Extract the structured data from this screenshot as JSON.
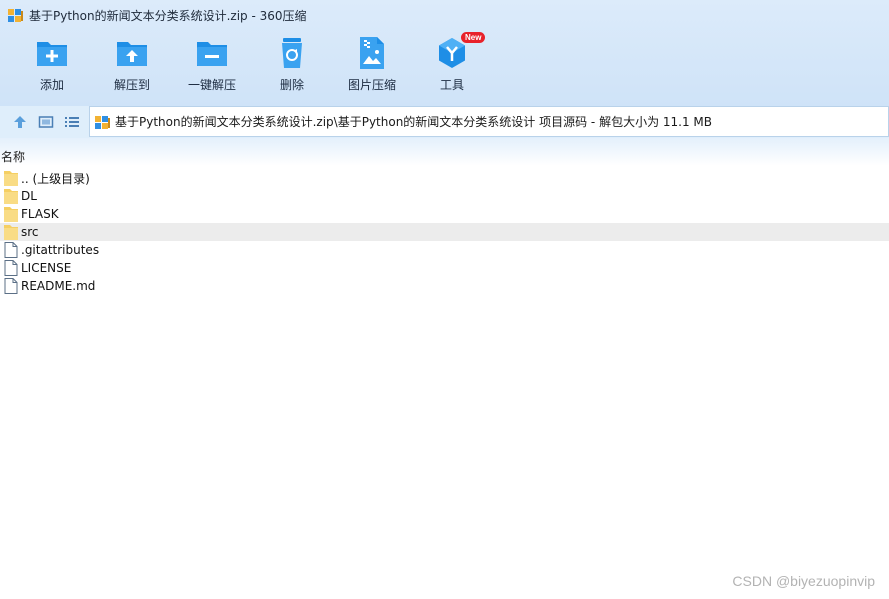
{
  "window": {
    "title": "基于Python的新闻文本分类系统设计.zip - 360压缩"
  },
  "toolbar": {
    "buttons": [
      {
        "label": "添加",
        "icon": "add-folder-icon"
      },
      {
        "label": "解压到",
        "icon": "extract-to-icon"
      },
      {
        "label": "一键解压",
        "icon": "one-click-extract-icon"
      },
      {
        "label": "删除",
        "icon": "recycle-delete-icon"
      },
      {
        "label": "图片压缩",
        "icon": "image-compress-icon"
      },
      {
        "label": "工具",
        "icon": "tools-cube-icon"
      }
    ],
    "new_badge": "New"
  },
  "address": {
    "path": "基于Python的新闻文本分类系统设计.zip\\基于Python的新闻文本分类系统设计 项目源码 - 解包大小为 11.1 MB"
  },
  "list": {
    "column_name": "名称",
    "items": [
      {
        "name": ".. (上级目录)",
        "type": "folder"
      },
      {
        "name": "DL",
        "type": "folder"
      },
      {
        "name": "FLASK",
        "type": "folder"
      },
      {
        "name": "src",
        "type": "folder",
        "selected": true
      },
      {
        "name": ".gitattributes",
        "type": "file"
      },
      {
        "name": "LICENSE",
        "type": "file"
      },
      {
        "name": "README.md",
        "type": "file"
      }
    ]
  },
  "watermark": "CSDN @biyezuopinvip",
  "colors": {
    "accent": "#1e8ee6",
    "badge": "#e8212a",
    "folder": "#f5cf63",
    "selected_row": "#ececec"
  }
}
